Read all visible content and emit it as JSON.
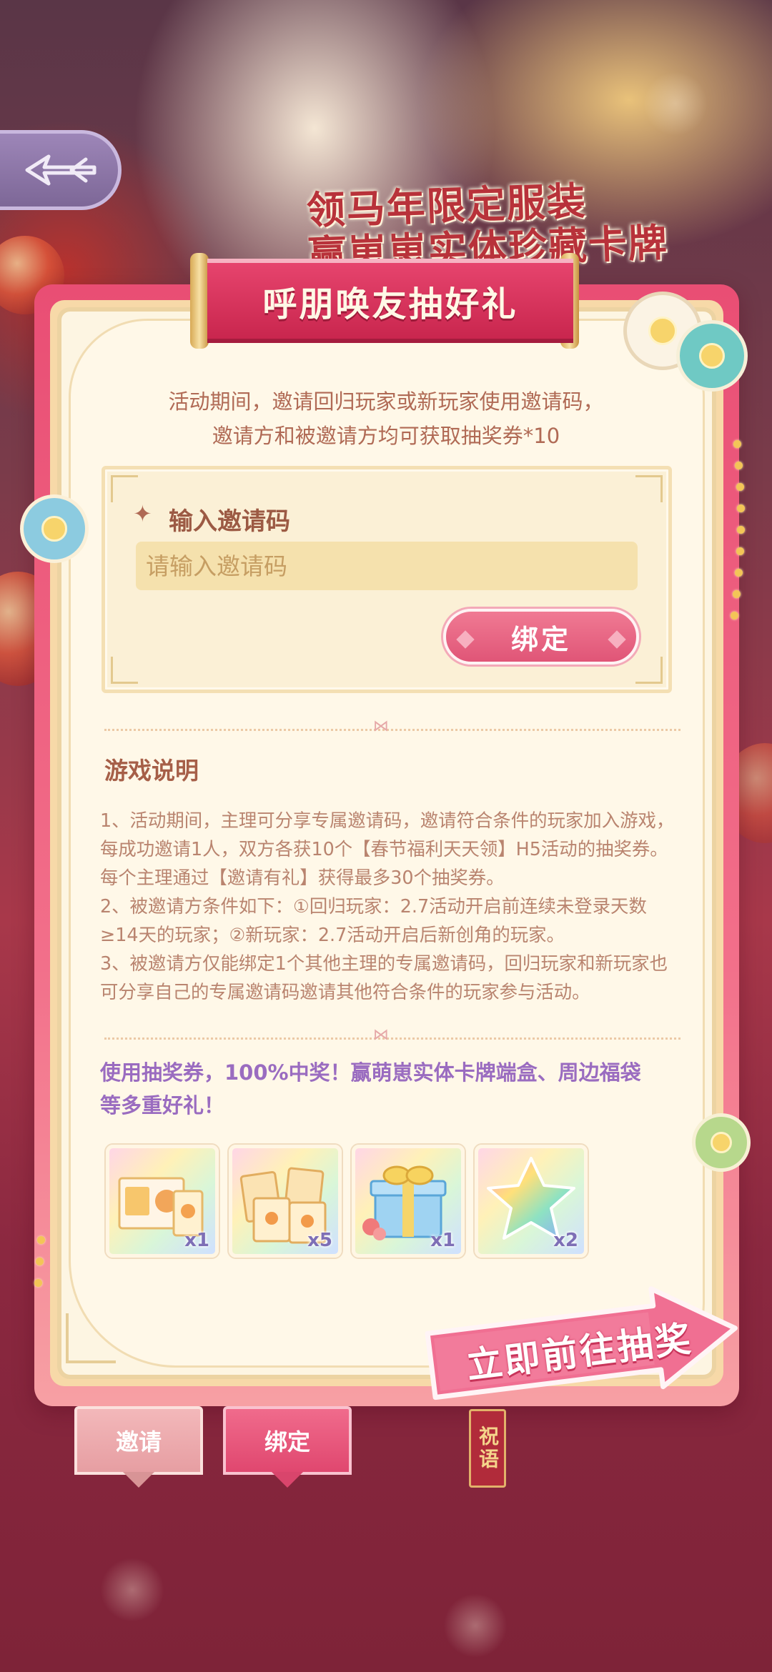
{
  "banner": {
    "headline_line1": "领马年限定服装",
    "headline_line2": "赢崽崽实体珍藏卡牌"
  },
  "back_button": {
    "icon": "back-arrow-icon"
  },
  "card": {
    "title": "呼朋唤友抽好礼",
    "intro_line1": "活动期间，邀请回归玩家或新玩家使用邀请码，",
    "intro_line2": "邀请方和被邀请方均可获取抽奖券*10"
  },
  "invite_code": {
    "label": "输入邀请码",
    "placeholder": "请输入邀请码",
    "value": "",
    "bind_label": "绑定"
  },
  "rules": {
    "title": "游戏说明",
    "items": [
      "1、活动期间，主理可分享专属邀请码，邀请符合条件的玩家加入游戏，每成功邀请1人，双方各获10个【春节福利天天领】H5活动的抽奖券。每个主理通过【邀请有礼】获得最多30个抽奖券。",
      "2、被邀请方条件如下：①回归玩家：2.7活动开启前连续未登录天数≥14天的玩家；②新玩家：2.7活动开启后新创角的玩家。",
      "3、被邀请方仅能绑定1个其他主理的专属邀请码，回归玩家和新玩家也可分享自己的专属邀请码邀请其他符合条件的玩家参与活动。"
    ]
  },
  "prizes": {
    "text_line1": "使用抽奖券，100%中奖！赢萌崽实体卡牌端盒、周边福袋",
    "text_line2": "等多重好礼！",
    "items": [
      {
        "name": "card-box-icon",
        "qty": "x1"
      },
      {
        "name": "card-packs-icon",
        "qty": "x5"
      },
      {
        "name": "gift-box-icon",
        "qty": "x1"
      },
      {
        "name": "rainbow-star-icon",
        "qty": "x2"
      }
    ]
  },
  "draw_button": {
    "label": "立即前往抽奖"
  },
  "tabs": {
    "invite": "邀请",
    "bind": "绑定",
    "scroll": "祝语"
  },
  "colors": {
    "ribbon": "#e6446d",
    "card_bg": "#fff8e8",
    "rules_text": "#b9846f",
    "prize_text": "#9a6cc0",
    "bind_button": "#e05577"
  }
}
